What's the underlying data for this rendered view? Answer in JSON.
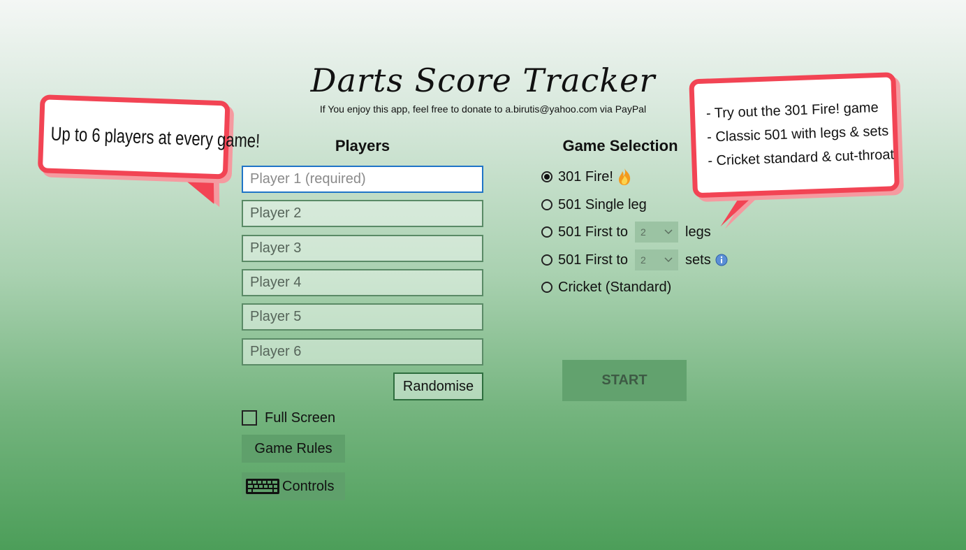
{
  "app": {
    "title": "Darts Score Tracker",
    "subtitle": "If You enjoy this app, feel free to donate to a.birutis@yahoo.com via PayPal"
  },
  "players": {
    "heading": "Players",
    "inputs": [
      {
        "placeholder": "Player 1 (required)"
      },
      {
        "placeholder": "Player 2"
      },
      {
        "placeholder": "Player 3"
      },
      {
        "placeholder": "Player 4"
      },
      {
        "placeholder": "Player 5"
      },
      {
        "placeholder": "Player 6"
      }
    ],
    "randomise_label": "Randomise"
  },
  "options": {
    "full_screen_label": "Full Screen",
    "full_screen_checked": false,
    "game_rules_label": "Game Rules",
    "controls_label": "Controls"
  },
  "game_selection": {
    "heading": "Game Selection",
    "options": [
      {
        "label": "301 Fire!",
        "selected": true,
        "icon": "fire-icon"
      },
      {
        "label": "501 Single leg",
        "selected": false
      },
      {
        "label": "501 First to",
        "selected": false,
        "value": "2",
        "suffix": "legs"
      },
      {
        "label": "501 First to",
        "selected": false,
        "value": "2",
        "suffix": "sets",
        "icon": "info-icon"
      },
      {
        "label": "Cricket (Standard)",
        "selected": false
      }
    ],
    "start_label": "START"
  },
  "callouts": {
    "left": "Up to 6 players at every game!",
    "right": [
      "- Try out the 301 Fire! game",
      "- Classic 501 with legs & sets",
      "- Cricket standard & cut-throat"
    ]
  },
  "colors": {
    "accent_focus": "#1f74c7",
    "callout_border": "#f24454",
    "button_fill": "#5fa06b"
  }
}
